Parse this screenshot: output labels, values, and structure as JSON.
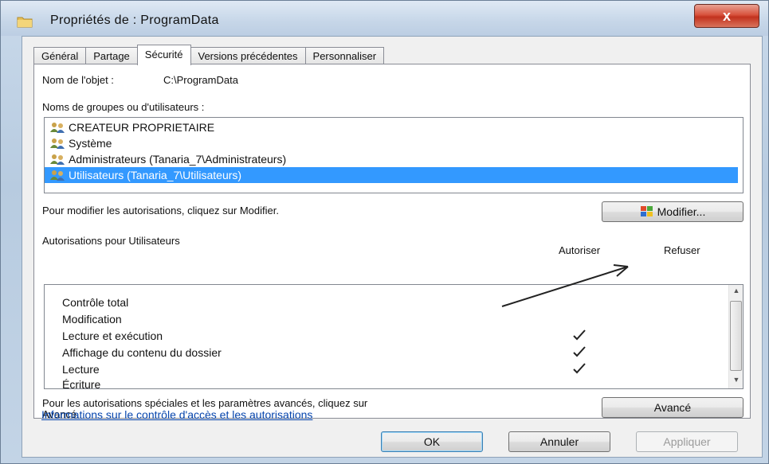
{
  "window": {
    "title": "Propriétés de : ProgramData",
    "close_label": "x"
  },
  "tabs": [
    {
      "label": "Général"
    },
    {
      "label": "Partage"
    },
    {
      "label": "Sécurité"
    },
    {
      "label": "Versions précédentes"
    },
    {
      "label": "Personnaliser"
    }
  ],
  "object": {
    "label": "Nom de l'objet :",
    "value": "C:\\ProgramData"
  },
  "groups": {
    "label": "Noms de groupes ou d'utilisateurs :",
    "items": [
      {
        "label": "CREATEUR PROPRIETAIRE"
      },
      {
        "label": "Système"
      },
      {
        "label": "Administrateurs (Tanaria_7\\Administrateurs)"
      },
      {
        "label": "Utilisateurs (Tanaria_7\\Utilisateurs)",
        "selected": true
      }
    ]
  },
  "modify": {
    "hint": "Pour modifier les autorisations, cliquez sur Modifier.",
    "button_label": "Modifier..."
  },
  "permissions": {
    "label": "Autorisations pour Utilisateurs",
    "col_allow": "Autoriser",
    "col_deny": "Refuser",
    "rows": [
      {
        "name": "Contrôle total",
        "allow": false,
        "deny": false
      },
      {
        "name": "Modification",
        "allow": false,
        "deny": false
      },
      {
        "name": "Lecture et exécution",
        "allow": true,
        "deny": false
      },
      {
        "name": "Affichage du contenu du dossier",
        "allow": true,
        "deny": false
      },
      {
        "name": "Lecture",
        "allow": true,
        "deny": false
      },
      {
        "name": "Écriture",
        "allow": false,
        "deny": false
      }
    ]
  },
  "advanced": {
    "hint_line1": "Pour les autorisations spéciales et les paramètres avancés, cliquez sur",
    "hint_line2": "Avancé.",
    "button_label": "Avancé"
  },
  "info_link": "Informations sur le contrôle d'accès et les autorisations",
  "footer": {
    "ok": "OK",
    "cancel": "Annuler",
    "apply": "Appliquer"
  },
  "colors": {
    "selection": "#3399ff",
    "link": "#0645ad",
    "close": "#c2321e"
  }
}
